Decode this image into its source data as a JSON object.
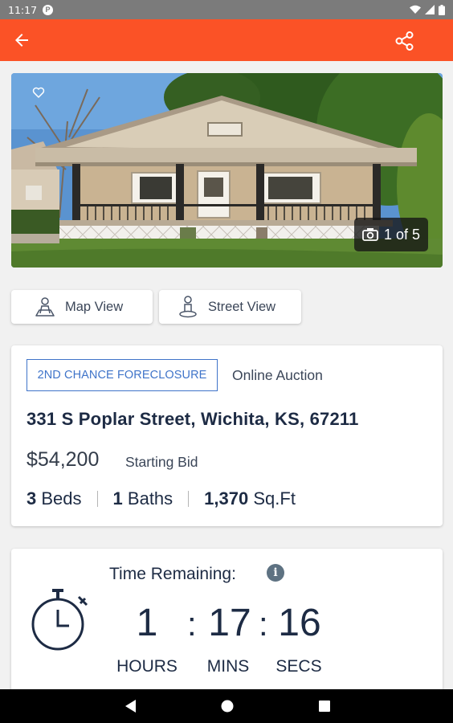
{
  "status_bar": {
    "time": "11:17",
    "app_badge": "P"
  },
  "photo": {
    "counter": "1 of 5"
  },
  "view_buttons": {
    "map": "Map View",
    "street": "Street View"
  },
  "listing": {
    "badge": "2ND CHANCE FORECLOSURE",
    "auction_type": "Online Auction",
    "address": "331 S Poplar Street, Wichita, KS, 67211",
    "price": "$54,200",
    "price_label": "Starting Bid",
    "beds_value": "3",
    "beds_label": "Beds",
    "baths_value": "1",
    "baths_label": "Baths",
    "sqft_value": "1,370",
    "sqft_label": "Sq.Ft"
  },
  "timer": {
    "label": "Time Remaining:",
    "info_glyph": "i",
    "hours": "1",
    "mins": "17",
    "secs": "16",
    "colon": ":",
    "hours_label": "HOURS",
    "mins_label": "MINS",
    "secs_label": "SECS"
  },
  "colors": {
    "brand": "#fb5226",
    "badge_blue": "#3f74c9",
    "navy_text": "#1d2b44"
  },
  "icons": [
    "back-arrow-icon",
    "share-icon",
    "heart-icon",
    "camera-icon",
    "map-person-icon",
    "street-person-icon",
    "info-icon",
    "stopwatch-icon",
    "nav-back-icon",
    "nav-home-icon",
    "nav-recents-icon",
    "wifi-icon",
    "signal-icon",
    "battery-icon"
  ]
}
